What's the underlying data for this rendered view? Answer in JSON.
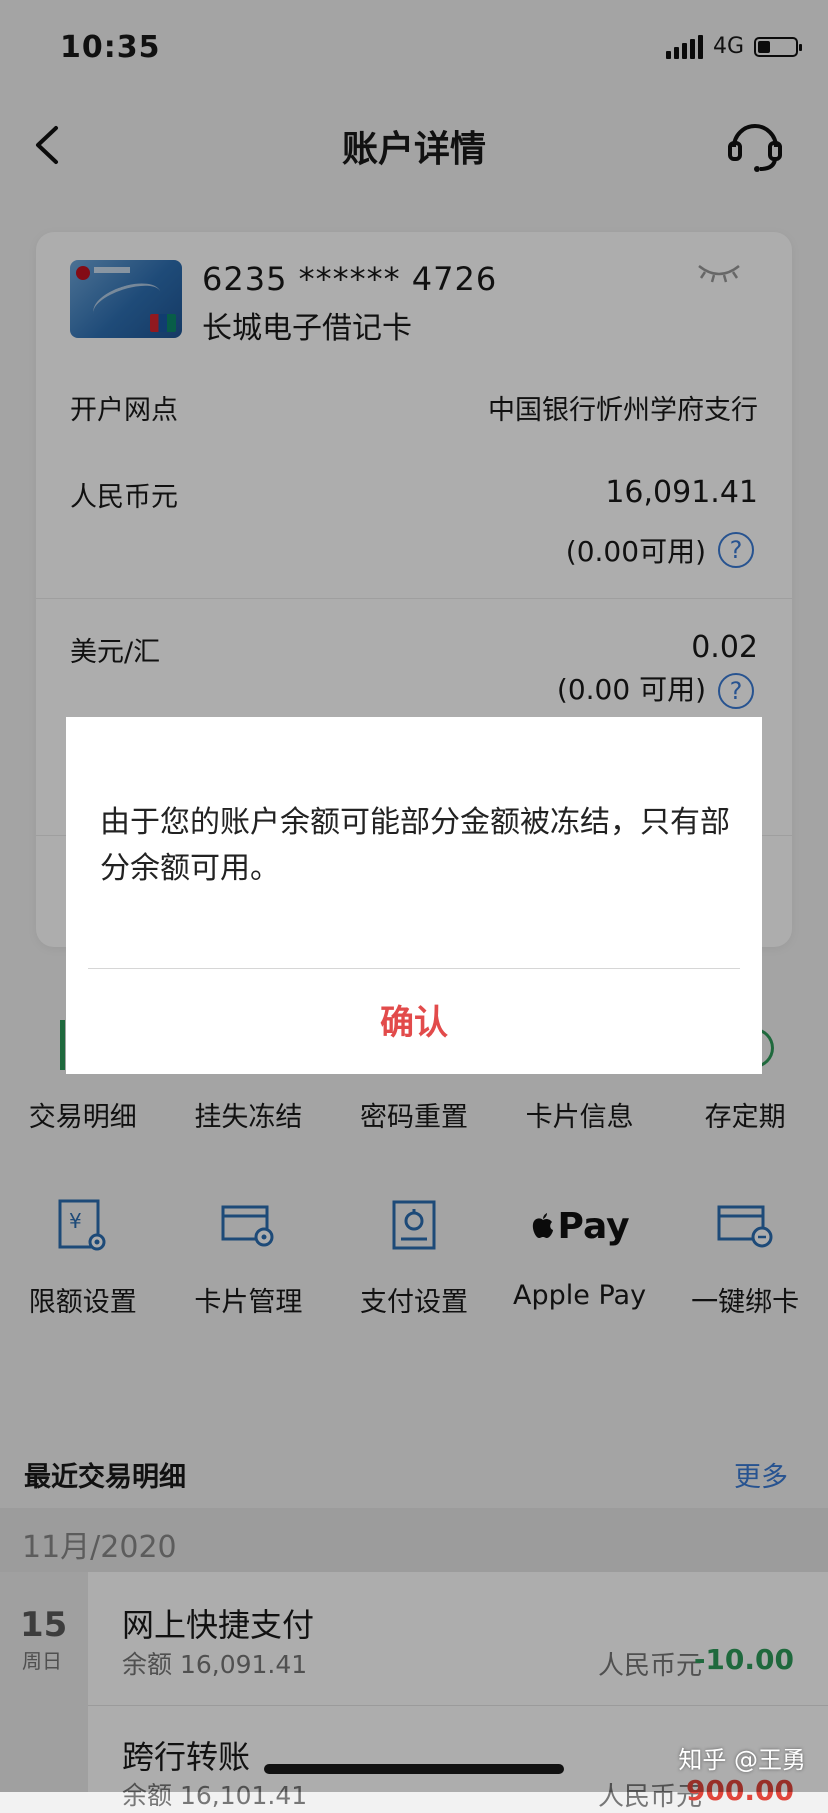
{
  "status_bar": {
    "time": "10:35",
    "network": "4G"
  },
  "nav": {
    "title": "账户详情"
  },
  "card": {
    "number": "6235 ****** 4726",
    "name": "长城电子借记卡",
    "branch_label": "开户网点",
    "branch_value": "中国银行忻州学府支行",
    "cny_label": "人民币元",
    "cny_amount": "16,091.41",
    "cny_available": "(0.00可用)",
    "usd_label": "美元/汇",
    "usd_amount": "0.02",
    "usd_available": "(0.00 可用)",
    "help_glyph": "?"
  },
  "quick_actions_row1": [
    "交易明细",
    "挂失冻结",
    "密码重置",
    "卡片信息",
    "存定期"
  ],
  "quick_actions_row2": {
    "icons": [
      "limit-settings-icon",
      "card-manage-icon",
      "payment-settings-icon",
      "apple-pay-icon",
      "bind-card-icon"
    ],
    "apple_pay_mark": "Pay",
    "labels": [
      "限额设置",
      "卡片管理",
      "支付设置",
      "Apple Pay",
      "一键绑卡"
    ]
  },
  "recent": {
    "title": "最近交易明细",
    "more": "更多",
    "month": "11月/2020",
    "day": "15",
    "weekday": "周日",
    "transactions": [
      {
        "title": "网上快捷支付",
        "balance": "余额 16,091.41",
        "currency": "人民币元",
        "amount": "-10.00"
      },
      {
        "title": "跨行转账",
        "balance": "余额 16,101.41",
        "currency": "人民币元",
        "amount": "900.00"
      }
    ]
  },
  "dialog": {
    "message": "由于您的账户余额可能部分金额被冻结，只有部分余额可用。",
    "confirm": "确认"
  },
  "watermark": "知乎 @王勇",
  "colors": {
    "accent_blue": "#3a7bd5",
    "confirm_red": "#e24b4b",
    "positive_green": "#2f9b5a",
    "debit_red": "#e0463c"
  }
}
